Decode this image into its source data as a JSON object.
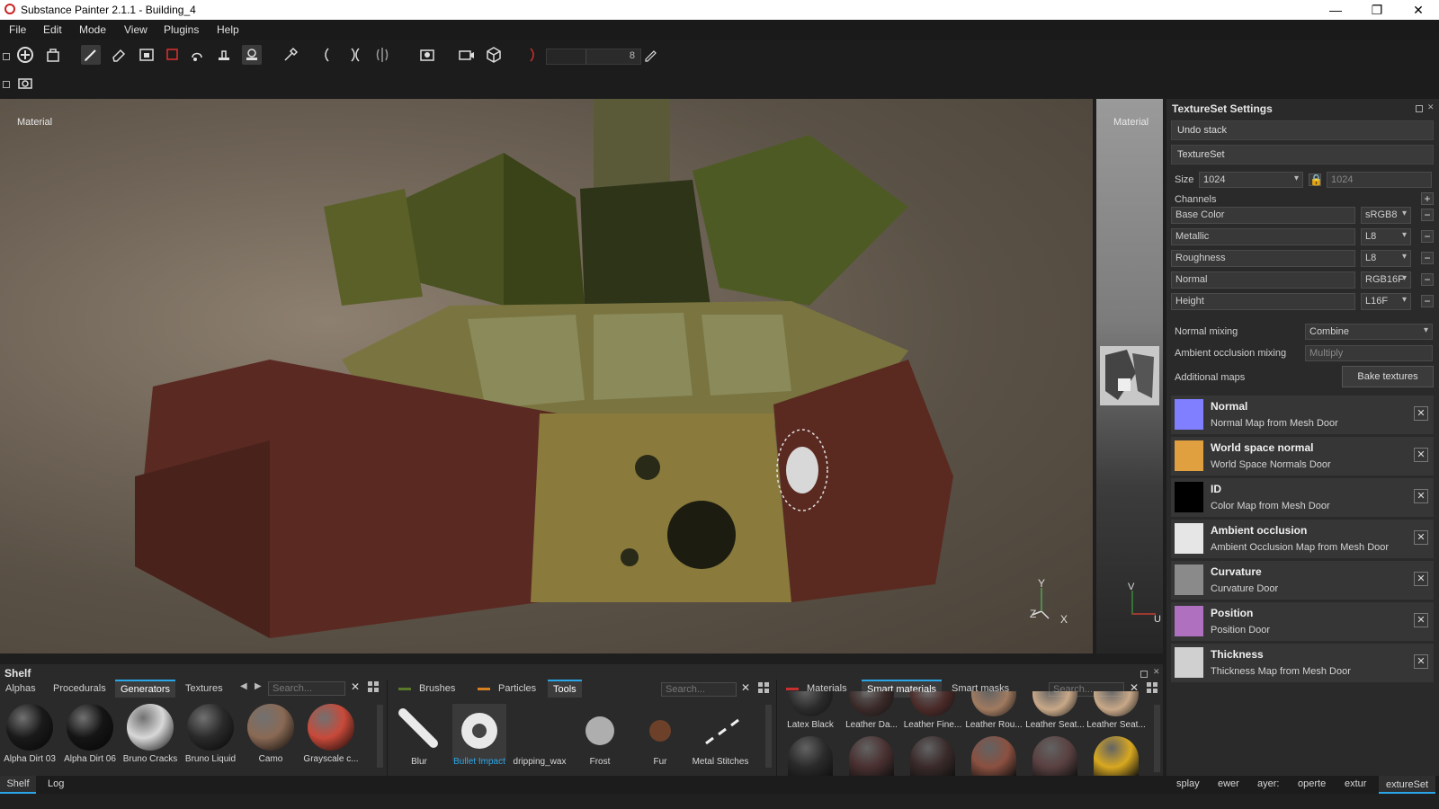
{
  "window": {
    "title": "Substance Painter 2.1.1 - Building_4",
    "controls": [
      "—",
      "❐",
      "✕"
    ]
  },
  "menu": [
    "File",
    "Edit",
    "Mode",
    "View",
    "Plugins",
    "Help"
  ],
  "toolbar": {
    "brush_size": "8"
  },
  "viewport": {
    "label_3d": "Material",
    "label_2d": "Material",
    "gizmo_3d": {
      "y": "Y",
      "z": "Z",
      "x": "X"
    },
    "gizmo_2d": {
      "v": "V",
      "u": "U"
    }
  },
  "textureset": {
    "title": "TextureSet Settings",
    "undo_stack": "Undo stack",
    "textureset": "TextureSet",
    "size_label": "Size",
    "size_value": "1024",
    "size_value2": "1024",
    "channels_label": "Channels",
    "channels": [
      {
        "name": "Base Color",
        "format": "sRGB8"
      },
      {
        "name": "Metallic",
        "format": "L8"
      },
      {
        "name": "Roughness",
        "format": "L8"
      },
      {
        "name": "Normal",
        "format": "RGB16F"
      },
      {
        "name": "Height",
        "format": "L16F"
      }
    ],
    "normal_mixing_label": "Normal mixing",
    "normal_mixing_value": "Combine",
    "ao_mixing_label": "Ambient occlusion mixing",
    "ao_mixing_value": "Multiply",
    "additional_maps_label": "Additional maps",
    "bake_button": "Bake textures",
    "maps": [
      {
        "title": "Normal",
        "subtitle": "Normal Map from Mesh Door",
        "swatch": "#7f7fff"
      },
      {
        "title": "World space normal",
        "subtitle": "World Space Normals Door",
        "swatch": "#e0a040"
      },
      {
        "title": "ID",
        "subtitle": "Color Map from Mesh Door",
        "swatch": "#000000"
      },
      {
        "title": "Ambient occlusion",
        "subtitle": "Ambient Occlusion Map from Mesh Door",
        "swatch": "#e6e6e6"
      },
      {
        "title": "Curvature",
        "subtitle": "Curvature Door",
        "swatch": "#8a8a8a"
      },
      {
        "title": "Position",
        "subtitle": "Position Door",
        "swatch": "#b070c0"
      },
      {
        "title": "Thickness",
        "subtitle": "Thickness Map from Mesh Door",
        "swatch": "#d0d0d0"
      }
    ],
    "remove_glyph": "✕"
  },
  "shelf": {
    "title": "Shelf",
    "left_tabs": [
      "Alphas",
      "Procedurals",
      "Generators",
      "Textures"
    ],
    "left_active": "Generators",
    "search_placeholder": "Search...",
    "left_items": [
      {
        "label": "Alpha Dirt 03",
        "color": "#1a1a1a"
      },
      {
        "label": "Alpha Dirt 06",
        "color": "#151515"
      },
      {
        "label": "Bruno Cracks",
        "color": "#d8d8d8"
      },
      {
        "label": "Bruno Liquid",
        "color": "#2a2a2a"
      },
      {
        "label": "Camo",
        "color": "#8a6a55"
      },
      {
        "label": "Grayscale c...",
        "color": "#c84a3a"
      }
    ],
    "mid_tabs": [
      "Brushes",
      "Particles",
      "Tools"
    ],
    "mid_active": "Tools",
    "mid_tab_colors": [
      "#5a7a2a",
      "#d88020",
      ""
    ],
    "mid_items": [
      {
        "label": "Blur"
      },
      {
        "label": "Bullet Impact"
      },
      {
        "label": "dripping_wax"
      },
      {
        "label": "Frost"
      },
      {
        "label": "Fur"
      },
      {
        "label": "Metal Stitches"
      }
    ],
    "right_tabs": [
      "Materials",
      "Smart materials",
      "Smart masks"
    ],
    "right_active": "Smart materials",
    "right_tab_color": "#c83030",
    "right_items": [
      {
        "label": "Latex Black",
        "color": "#2a2a2a"
      },
      {
        "label": "Leather Da...",
        "color": "#3a2a28"
      },
      {
        "label": "Leather Fine...",
        "color": "#4a2a28"
      },
      {
        "label": "Leather Rou...",
        "color": "#a07a60"
      },
      {
        "label": "Leather Seat...",
        "color": "#c8a888"
      },
      {
        "label": "Leather Seat...",
        "color": "#c8a888"
      }
    ],
    "right_row2_colors": [
      "#2a2a2a",
      "#4a3030",
      "#3a2a2a",
      "#8a5040",
      "#5a4040",
      "#d8a820"
    ]
  },
  "bottom_tabs": {
    "left": [
      "Shelf",
      "Log"
    ],
    "left_active": "Shelf",
    "right": [
      "splay",
      "ewer",
      "ayer:",
      "operte",
      "extur",
      "extureSet"
    ],
    "right_active": "extureSet"
  },
  "colors": {
    "accent": "#2aa6e8",
    "panel": "#2a2a2a"
  }
}
